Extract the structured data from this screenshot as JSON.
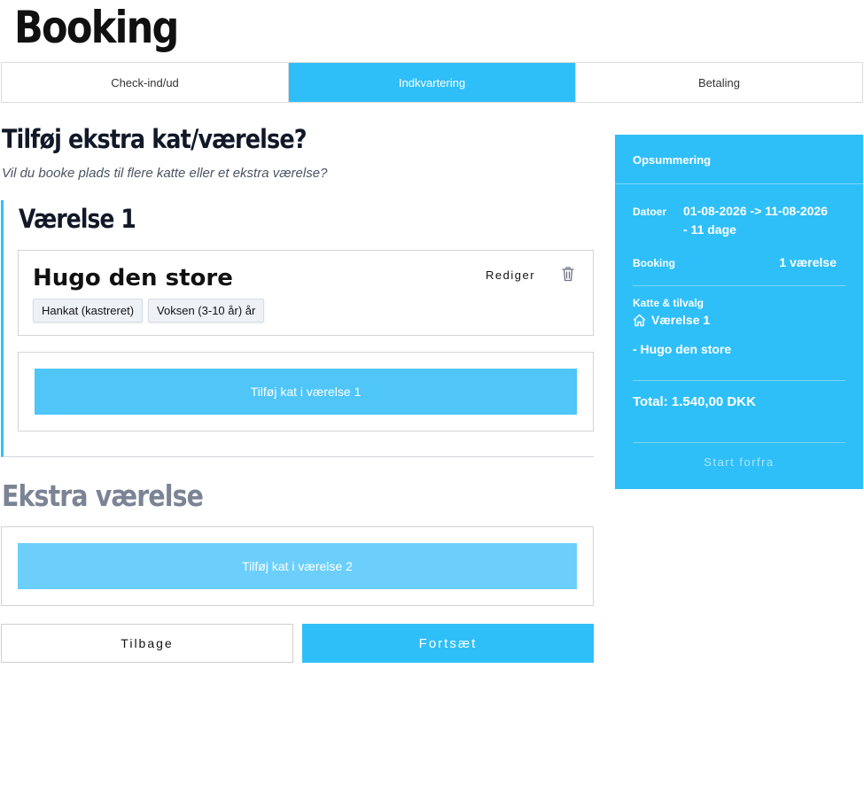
{
  "page": {
    "title": "Booking"
  },
  "steps": [
    {
      "label": "Check-ind/ud",
      "active": false
    },
    {
      "label": "Indkvartering",
      "active": true
    },
    {
      "label": "Betaling",
      "active": false
    }
  ],
  "question": {
    "title": "Tilføj ekstra kat/værelse?",
    "subtitle": "Vil du booke plads til flere katte eller et ekstra værelse?"
  },
  "room1": {
    "title": "Værelse 1",
    "cat": {
      "name": "Hugo den store",
      "tags": [
        "Hankat (kastreret)",
        "Voksen (3-10 år) år"
      ],
      "edit_label": "Rediger",
      "delete_icon": "trash-icon"
    },
    "add_cat_label": "Tilføj kat i værelse 1"
  },
  "extra_room": {
    "title": "Ekstra værelse",
    "add_cat_label": "Tilføj kat i værelse 2"
  },
  "nav": {
    "back_label": "Tilbage",
    "next_label": "Fortsæt"
  },
  "summary": {
    "title": "Opsummering",
    "dates_label": "Datoer",
    "dates_line1": "01-08-2026 -> 11-08-2026",
    "dates_line2": "- 11 dage",
    "booking_label": "Booking",
    "booking_value": "1 værelse",
    "cats_label": "Katte & tilvalg",
    "room_label": "Værelse 1",
    "room_icon": "home-icon",
    "cat_line": "- Hugo den store",
    "total": "Total: 1.540,00 DKK",
    "start_label": "Start forfra"
  },
  "colors": {
    "accent": "#2fbff8",
    "accent_light": "#4fc5f8",
    "muted_heading": "#7a8494"
  }
}
